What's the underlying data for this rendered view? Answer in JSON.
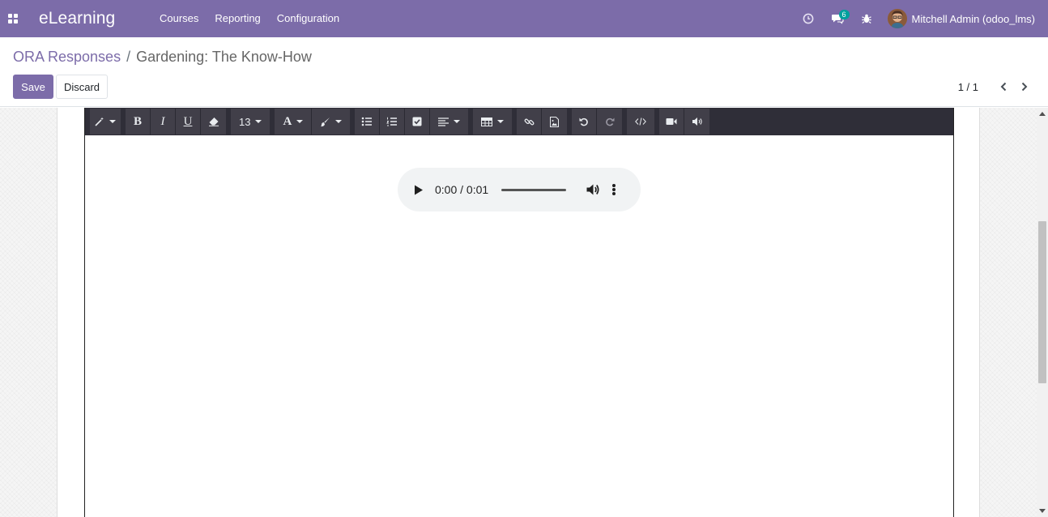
{
  "navbar": {
    "brand": "eLearning",
    "menu": [
      "Courses",
      "Reporting",
      "Configuration"
    ],
    "messages_count": "6",
    "user_name": "Mitchell Admin (odoo_lms)"
  },
  "breadcrumb": {
    "parent": "ORA Responses",
    "separator": "/",
    "current": "Gardening: The Know-How"
  },
  "buttons": {
    "save": "Save",
    "discard": "Discard"
  },
  "pager": {
    "value": "1 / 1"
  },
  "toolbar": {
    "font_size": "13",
    "bold": "B",
    "italic": "I",
    "underline": "U",
    "font_color": "A"
  },
  "audio": {
    "time": "0:00 / 0:01",
    "progress": 0
  },
  "colors": {
    "navbar": "#7c6ca9",
    "primary": "#7c6ca9",
    "badge": "#00a09d",
    "toolbar": "#2f2e38"
  }
}
